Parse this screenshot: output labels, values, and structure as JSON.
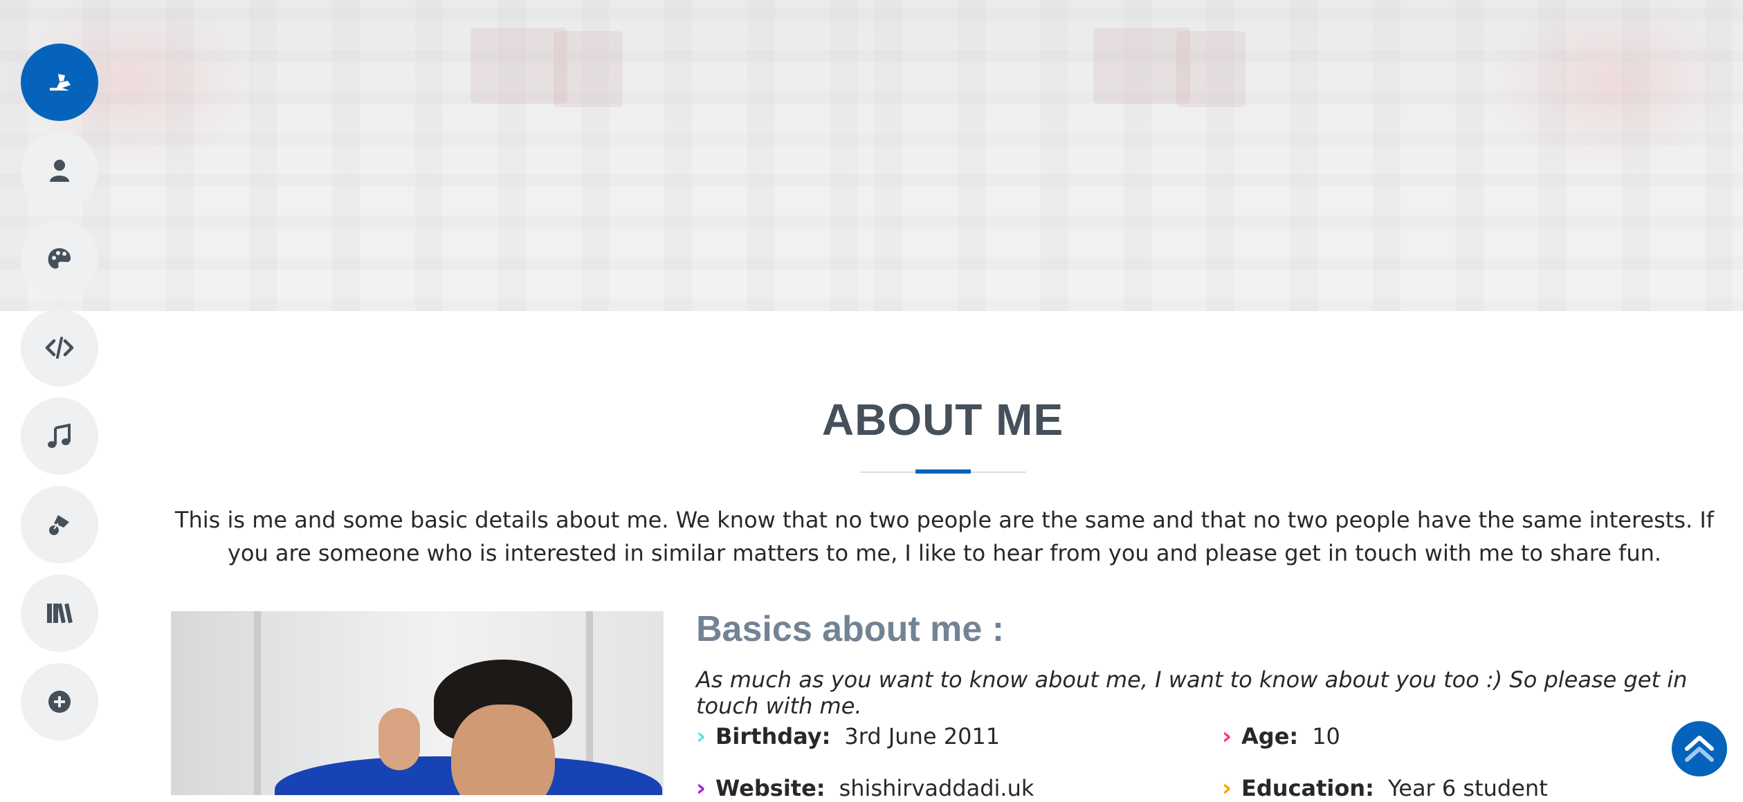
{
  "nav": {
    "items": [
      {
        "name": "home",
        "icon": "airplane-seat-icon",
        "active": true
      },
      {
        "name": "about",
        "icon": "person-icon"
      },
      {
        "name": "art",
        "icon": "palette-icon"
      },
      {
        "name": "code",
        "icon": "code-icon"
      },
      {
        "name": "music",
        "icon": "music-note-icon"
      },
      {
        "name": "sports",
        "icon": "badminton-icon"
      },
      {
        "name": "library",
        "icon": "books-icon"
      },
      {
        "name": "more",
        "icon": "plus-circle-icon"
      }
    ]
  },
  "about": {
    "title": "ABOUT ME",
    "intro": "This is me and some basic details about me. We know that no two people are the same and that no two people have the same interests. If you are someone who is interested in similar matters to me, I like to hear from you and please get in touch with me to share fun.",
    "basics_title": "Basics about me :",
    "basics_subtitle": "As much as you want to know about me, I want to know about you too :) So please get in touch with me.",
    "details": [
      {
        "label": "Birthday:",
        "value": "3rd June 2011",
        "chevron_color": "#5ce1e6"
      },
      {
        "label": "Age:",
        "value": "10",
        "chevron_color": "#ff2d8c"
      },
      {
        "label": "Website:",
        "value": "shishirvaddadi.uk",
        "chevron_color": "#a31ee0"
      },
      {
        "label": "Education:",
        "value": "Year 6 student",
        "chevron_color": "#f2a900"
      }
    ]
  },
  "back_to_top": {
    "icon": "double-chevron-up-icon"
  },
  "colors": {
    "accent": "#0563bb",
    "title": "#45505b",
    "subtitle": "#728394"
  }
}
